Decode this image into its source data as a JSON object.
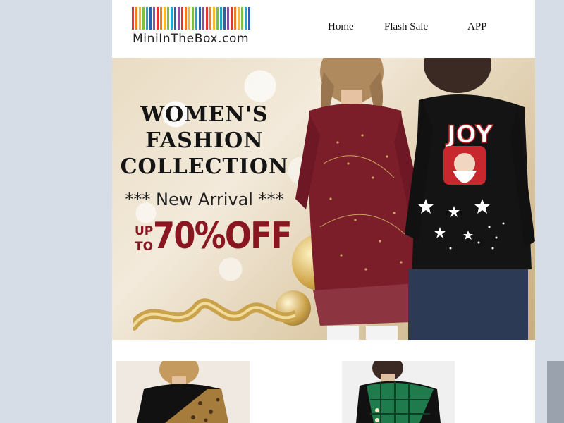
{
  "header": {
    "logo_text": "MiniInTheBox.com",
    "logo_bar_colors": [
      "#e8302f",
      "#f47b20",
      "#fbb829",
      "#7cc242",
      "#1fa9c9",
      "#2e5fac",
      "#8a52a0",
      "#e8302f",
      "#f47b20",
      "#fbb829",
      "#7cc242",
      "#1fa9c9",
      "#2e5fac",
      "#8a52a0",
      "#e8302f",
      "#f47b20",
      "#fbb829",
      "#7cc242",
      "#1fa9c9",
      "#2e5fac",
      "#8a52a0",
      "#e8302f",
      "#f47b20",
      "#fbb829",
      "#7cc242",
      "#1fa9c9",
      "#2e5fac",
      "#8a52a0",
      "#e8302f",
      "#f47b20",
      "#fbb829",
      "#7cc242",
      "#1fa9c9",
      "#2e5fac"
    ],
    "nav": [
      {
        "label": "Home"
      },
      {
        "label": "Flash Sale"
      },
      {
        "label": "APP"
      }
    ]
  },
  "banner": {
    "title_lines": [
      "WOMEN'S",
      "FASHION",
      "COLLECTION"
    ],
    "arrival": "*** New Arrival ***",
    "sale_prefix": "UP TO",
    "sale_main": "70%OFF",
    "sale_color": "#8a1621",
    "model_left_top": "burgundy-dot-print-top",
    "model_right_top": "black-joy-santa-sweatshirt",
    "sweatshirt_text": "JOY"
  },
  "products": [
    {
      "icon": "leopard-colorblock-top-image"
    },
    {
      "icon": "green-plaid-button-top-image"
    },
    {
      "icon": "partial-product-image"
    }
  ]
}
